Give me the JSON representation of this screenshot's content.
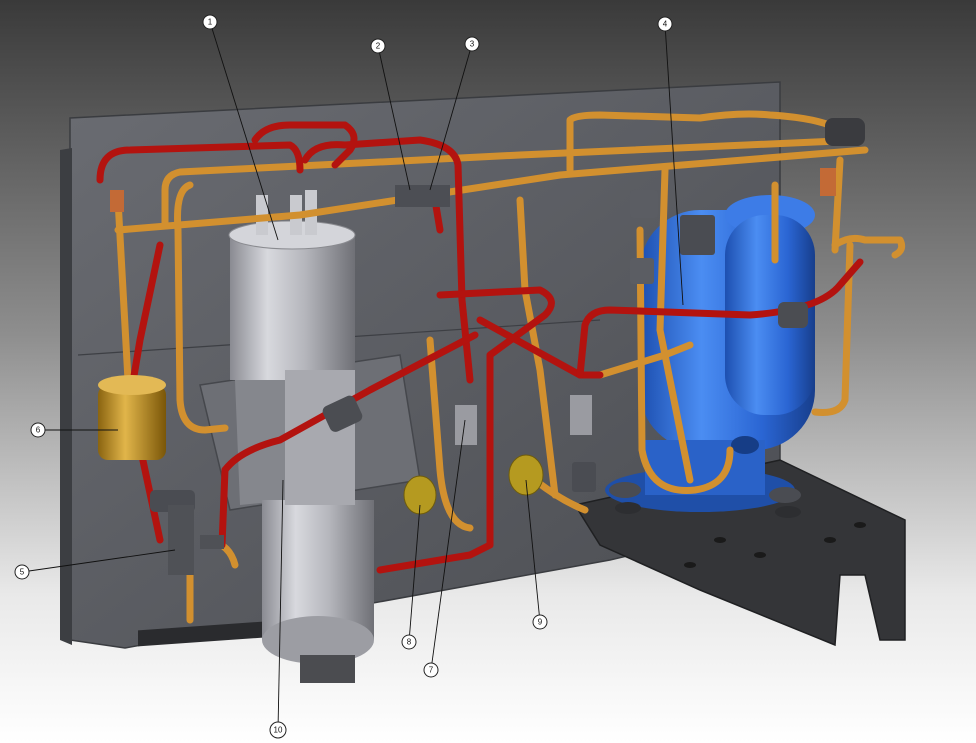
{
  "diagram": {
    "callouts": [
      {
        "id": "1",
        "text": "1"
      },
      {
        "id": "2",
        "text": "2"
      },
      {
        "id": "3",
        "text": "3"
      },
      {
        "id": "4",
        "text": "4"
      },
      {
        "id": "5",
        "text": "5"
      },
      {
        "id": "6",
        "text": "6"
      },
      {
        "id": "7",
        "text": "7"
      },
      {
        "id": "8",
        "text": "8"
      },
      {
        "id": "9",
        "text": "9"
      },
      {
        "id": "10",
        "text": "10"
      }
    ],
    "colors": {
      "background_top": "#3a3a3a",
      "background_bottom": "#ffffff",
      "panel": "#56585e",
      "copper_pipe": "#d2902f",
      "red_pipe": "#b3130f",
      "compressor": "#2e6fe0",
      "cylinder": "#b9bac2",
      "brass": "#c79a2a",
      "callout_fill": "#ffffff",
      "callout_stroke": "#222222"
    }
  }
}
